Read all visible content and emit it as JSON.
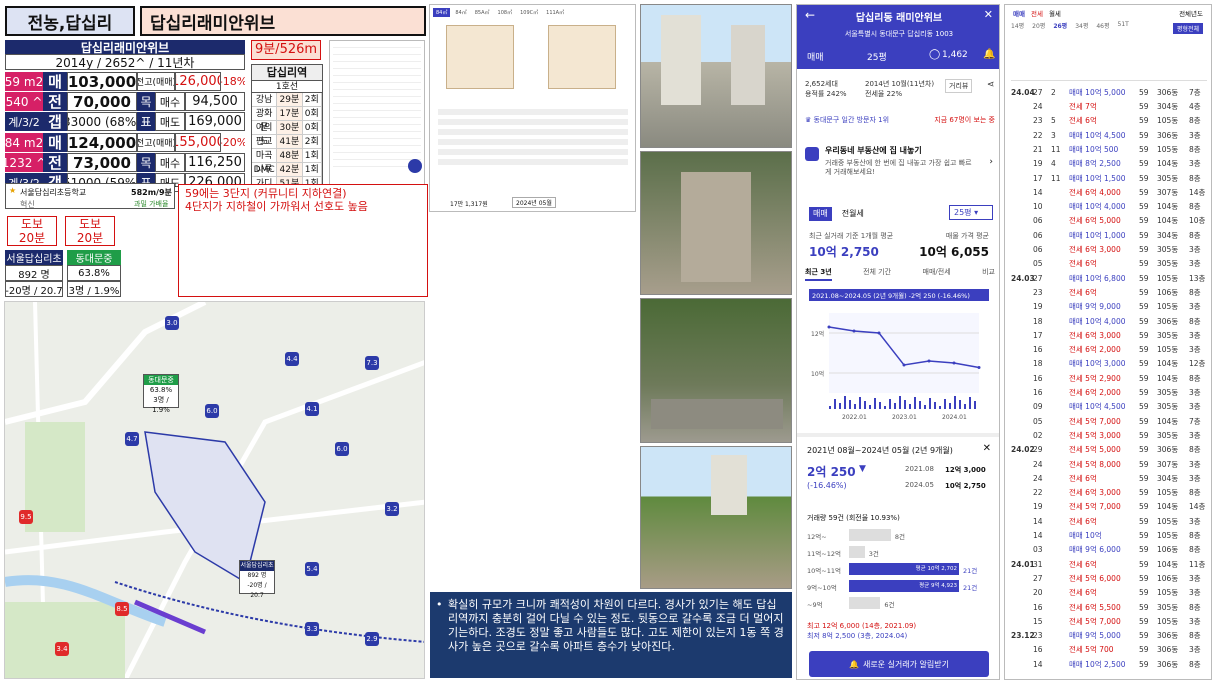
{
  "header": {
    "area": "전농,답십리",
    "complex": "답십리래미안위브"
  },
  "info": {
    "name": "답십리래미안위브",
    "summary": "2014y / 2652^ / 11년차",
    "rows": [
      {
        "size": "59 m2",
        "t1": "매",
        "v1": "103,000",
        "l2": "전고(매매)",
        "v2": "126,000",
        "pct": "-18%"
      },
      {
        "size": "540 ^",
        "t1": "전",
        "v1": "70,000",
        "l2a": "목",
        "l2b": "매수",
        "v2": "94,500"
      },
      {
        "size": "계/3/2",
        "t1": "갭",
        "v1": "33000 (68%)",
        "l2a": "표",
        "l2b": "매도",
        "v2": "169,000"
      },
      {
        "size": "84 m2",
        "t1": "매",
        "v1": "124,000",
        "l2": "전고(매매)",
        "v2": "155,000",
        "pct": "-20%"
      },
      {
        "size": "1232 ^",
        "t1": "전",
        "v1": "73,000",
        "l2a": "목",
        "l2b": "매수",
        "v2": "116,250"
      },
      {
        "size": "계/3/2",
        "t1": "갭",
        "v1": "51000 (59%)",
        "l2a": "표",
        "l2b": "매도",
        "v2": "226,000"
      }
    ],
    "school": {
      "name": "서울답십리초등학교",
      "dist": "582m/9분",
      "tag": "혁신",
      "note": "과밀 가배율"
    },
    "walk": [
      {
        "label": "도보",
        "val": "20분"
      },
      {
        "label": "도보",
        "val": "20분"
      }
    ],
    "stations": [
      {
        "name": "서울답십리초",
        "count": "892 명",
        "ratio": "-20명 / 20.7"
      },
      {
        "name": "동대문중",
        "count": "63.8%",
        "ratio": "3명 / 1.9%"
      }
    ]
  },
  "subway": {
    "time": "9분/526m",
    "station": "답십리역",
    "line": "1호선",
    "rows": [
      {
        "name": "강남",
        "time": "29분",
        "transfer": "2회"
      },
      {
        "name": "광화문",
        "time": "17분",
        "transfer": "0회"
      },
      {
        "name": "여의도",
        "time": "30분",
        "transfer": "0회"
      },
      {
        "name": "판교",
        "time": "41분",
        "transfer": "2회"
      },
      {
        "name": "마곡나루",
        "time": "48분",
        "transfer": "1회"
      },
      {
        "name": "DMC",
        "time": "42분",
        "transfer": "1회"
      },
      {
        "name": "가디",
        "time": "51분",
        "transfer": "1회"
      }
    ]
  },
  "note": {
    "line1": "59에는 3단지 (커뮤니티 지하연결)",
    "line2": "4단지가 지하철이 가까워서 선호도 높음"
  },
  "map_labels": {
    "school1": "동대문중",
    "school1_v": "63.8%",
    "school1_r": "3명 / 1.9%",
    "school2": "서울답십리초",
    "school2_v": "892 명",
    "school2_r": "-20명 / 20.7"
  },
  "floorplan": {
    "tabs": [
      "84㎡",
      "84㎡",
      "85A㎡",
      "108㎡",
      "109C㎡",
      "111A㎡"
    ],
    "footer": "17만 1,317원",
    "btn": "2024년 05월"
  },
  "comment": "확실히 규모가 크니까 쾌적성이 차원이 다르다. 경사가 있기는 해도 답십리역까지 충분히 걸어 다닐 수 있는 정도. 뒷동으로 갈수록 조금 더 멀어지기는하다. 조경도 정말 좋고 사람들도 많다. 고도 제한이 있는지 1동 쪽 경사가 높은 곳으로 갈수록 아파트 층수가 낮아진다.",
  "app": {
    "title": "답십리동 래미안위브",
    "address": "서울특별시 동대문구 답십리동 1003",
    "tab1": "매매",
    "tab2": "25평",
    "likes": "1,462",
    "units": "2,652세대",
    "ratio": "용적률 242%",
    "built": "2014년 10월(11년차)",
    "jeonse": "전세율 22%",
    "btn": "거리뷰",
    "rank": "동대문구 일간 방문자 1위",
    "rank2": "지금 67명이 보는 중",
    "promo_t": "우리동네 부동산에 집 내놓기",
    "promo_d": "거래중 부동산에 한 번에 집 내놓고 가장 쉽고 빠르게 거래해보세요!",
    "seg1": "매매",
    "seg2": "전월세",
    "sel": "25평",
    "avg_lbl": "최근 실거래 기준 1개월 평균",
    "avg": "10억 2,750",
    "ask_lbl": "매물 가격 평균",
    "ask": "10억 6,055",
    "ctabs": [
      "최근 3년",
      "전체 기간",
      "매매/전세",
      "비교"
    ],
    "chart_range": "2021.08~2024.05 (2년 9개월) -2억 250 (-16.46%)",
    "sum_period": "2021년 08월~2024년 05월 (2년 9개월)",
    "change": "2억 250",
    "change_pct": "(-16.46%)",
    "p1d": "2021.08",
    "p1v": "12억 3,000",
    "p2d": "2024.05",
    "p2v": "10억 2,750",
    "trades": "거래량 59건 (회전율 10.93%)",
    "bars": [
      {
        "label": "12억~",
        "val": "8건",
        "n": 8
      },
      {
        "label": "11억~12억",
        "val": "3건",
        "n": 3
      },
      {
        "label": "10억~11억",
        "val": "21건",
        "n": 21,
        "note": "평균 10억 2,702"
      },
      {
        "label": "9억~10억",
        "val": "21건",
        "n": 21,
        "note": "평균 9억 4,923"
      },
      {
        "label": "~9억",
        "val": "6건",
        "n": 6
      }
    ],
    "max": "최고 12억 6,000 (14층, 2021.09)",
    "min": "최저 8억 2,500 (3층, 2024.04)",
    "cta": "새로운 실거래가 알림받기"
  },
  "list": {
    "tabs": [
      "매매",
      "전세",
      "월세"
    ],
    "filter": "전체년도",
    "sizes": [
      "14평",
      "20평",
      "26평",
      "34평",
      "46평",
      "51T"
    ],
    "btn": "평형전체",
    "rows": [
      [
        "24.04",
        "27",
        "2",
        "매매 10억 5,000",
        "59",
        "306동",
        "7층"
      ],
      [
        "",
        "24",
        "",
        "전세 7억",
        "59",
        "304동",
        "4층"
      ],
      [
        "",
        "23",
        "5",
        "전세 6억",
        "59",
        "105동",
        "8층"
      ],
      [
        "",
        "22",
        "3",
        "매매 10억 4,500",
        "59",
        "306동",
        "3층"
      ],
      [
        "",
        "21",
        "11",
        "매매 10억 500",
        "59",
        "105동",
        "8층"
      ],
      [
        "",
        "19",
        "4",
        "매매 8억 2,500",
        "59",
        "104동",
        "3층"
      ],
      [
        "",
        "17",
        "11",
        "매매 10억 1,500",
        "59",
        "305동",
        "8층"
      ],
      [
        "",
        "14",
        "",
        "전세 6억 4,000",
        "59",
        "307동",
        "14층"
      ],
      [
        "",
        "10",
        "",
        "매매 10억 4,000",
        "59",
        "104동",
        "8층"
      ],
      [
        "",
        "06",
        "",
        "전세 6억 5,000",
        "59",
        "104동",
        "10층"
      ],
      [
        "",
        "06",
        "",
        "매매 10억 1,000",
        "59",
        "304동",
        "8층"
      ],
      [
        "",
        "06",
        "",
        "전세 6억 3,000",
        "59",
        "305동",
        "3층"
      ],
      [
        "",
        "05",
        "",
        "전세 6억",
        "59",
        "305동",
        "3층"
      ],
      [
        "24.03",
        "27",
        "",
        "매매 10억 6,800",
        "59",
        "105동",
        "13층"
      ],
      [
        "",
        "23",
        "",
        "전세 6억",
        "59",
        "106동",
        "8층"
      ],
      [
        "",
        "19",
        "",
        "매매 9억 9,000",
        "59",
        "105동",
        "3층"
      ],
      [
        "",
        "18",
        "",
        "매매 10억 4,000",
        "59",
        "306동",
        "8층"
      ],
      [
        "",
        "17",
        "",
        "전세 6억 3,000",
        "59",
        "305동",
        "3층"
      ],
      [
        "",
        "16",
        "",
        "전세 6억 2,000",
        "59",
        "105동",
        "3층"
      ],
      [
        "",
        "18",
        "",
        "매매 10억 3,000",
        "59",
        "104동",
        "12층"
      ],
      [
        "",
        "16",
        "",
        "전세 5억 2,900",
        "59",
        "104동",
        "8층"
      ],
      [
        "",
        "16",
        "",
        "전세 6억 2,000",
        "59",
        "305동",
        "3층"
      ],
      [
        "",
        "09",
        "",
        "매매 10억 4,500",
        "59",
        "305동",
        "3층"
      ],
      [
        "",
        "05",
        "",
        "전세 5억 7,000",
        "59",
        "104동",
        "7층"
      ],
      [
        "",
        "02",
        "",
        "전세 5억 3,000",
        "59",
        "305동",
        "3층"
      ],
      [
        "24.02",
        "29",
        "",
        "전세 5억 5,000",
        "59",
        "306동",
        "8층"
      ],
      [
        "",
        "24",
        "",
        "전세 5억 8,000",
        "59",
        "307동",
        "3층"
      ],
      [
        "",
        "24",
        "",
        "전세 6억",
        "59",
        "304동",
        "3층"
      ],
      [
        "",
        "22",
        "",
        "전세 6억 3,000",
        "59",
        "105동",
        "8층"
      ],
      [
        "",
        "19",
        "",
        "전세 5억 7,000",
        "59",
        "104동",
        "14층"
      ],
      [
        "",
        "14",
        "",
        "전세 6억",
        "59",
        "105동",
        "3층"
      ],
      [
        "",
        "14",
        "",
        "매매 10억",
        "59",
        "105동",
        "8층"
      ],
      [
        "",
        "03",
        "",
        "매매 9억 6,000",
        "59",
        "106동",
        "8층"
      ],
      [
        "24.01",
        "31",
        "",
        "전세 6억",
        "59",
        "104동",
        "11층"
      ],
      [
        "",
        "27",
        "",
        "전세 5억 6,000",
        "59",
        "106동",
        "3층"
      ],
      [
        "",
        "20",
        "",
        "전세 6억",
        "59",
        "105동",
        "3층"
      ],
      [
        "",
        "16",
        "",
        "전세 6억 5,500",
        "59",
        "305동",
        "8층"
      ],
      [
        "",
        "15",
        "",
        "전세 5억 7,000",
        "59",
        "105동",
        "3층"
      ],
      [
        "23.12",
        "23",
        "",
        "매매 9억 5,000",
        "59",
        "306동",
        "8층"
      ],
      [
        "",
        "16",
        "",
        "전세 5억 700",
        "59",
        "306동",
        "3층"
      ],
      [
        "",
        "14",
        "",
        "매매 10억 2,500",
        "59",
        "306동",
        "8층"
      ]
    ]
  },
  "chart_data": {
    "type": "line",
    "x": [
      "2021.08",
      "2022.01",
      "2022.06",
      "2023.01",
      "2023.06",
      "2024.01",
      "2024.05"
    ],
    "series": [
      {
        "values": [
          12.3,
          12.1,
          12.0,
          10.4,
          10.6,
          10.5,
          10.275
        ]
      }
    ],
    "ylim": [
      9,
      13
    ],
    "ytick_labels": [
      "12억",
      "10억"
    ],
    "xtick_labels": [
      "2022.01",
      "2023.01",
      "2024.01"
    ]
  }
}
